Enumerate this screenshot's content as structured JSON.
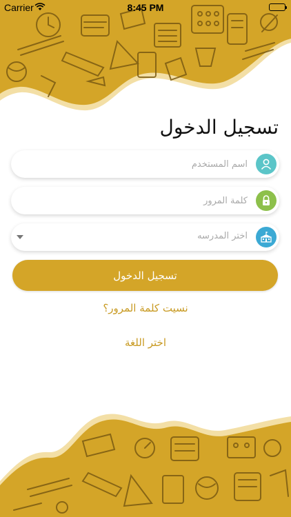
{
  "status_bar": {
    "carrier": "Carrier",
    "time": "8:45 PM"
  },
  "colors": {
    "accent": "#D4A528",
    "accent_dark": "#B8871B",
    "doodle": "#7A5A12",
    "user_icon_bg": "#5BC5C8",
    "lock_icon_bg": "#8DC04B",
    "school_icon_bg": "#3BA9D4"
  },
  "login": {
    "title": "تسجيل الدخول",
    "username": {
      "placeholder": "اسم المستخدم",
      "icon": "user-icon"
    },
    "password": {
      "placeholder": "كلمة المرور",
      "icon": "lock-icon"
    },
    "school": {
      "placeholder": "اختر المدرسه",
      "icon": "school-icon"
    },
    "submit_label": "تسجيل الدخول",
    "forgot_password": "نسيت كلمة المرور؟",
    "choose_language": "اختر اللغة"
  }
}
